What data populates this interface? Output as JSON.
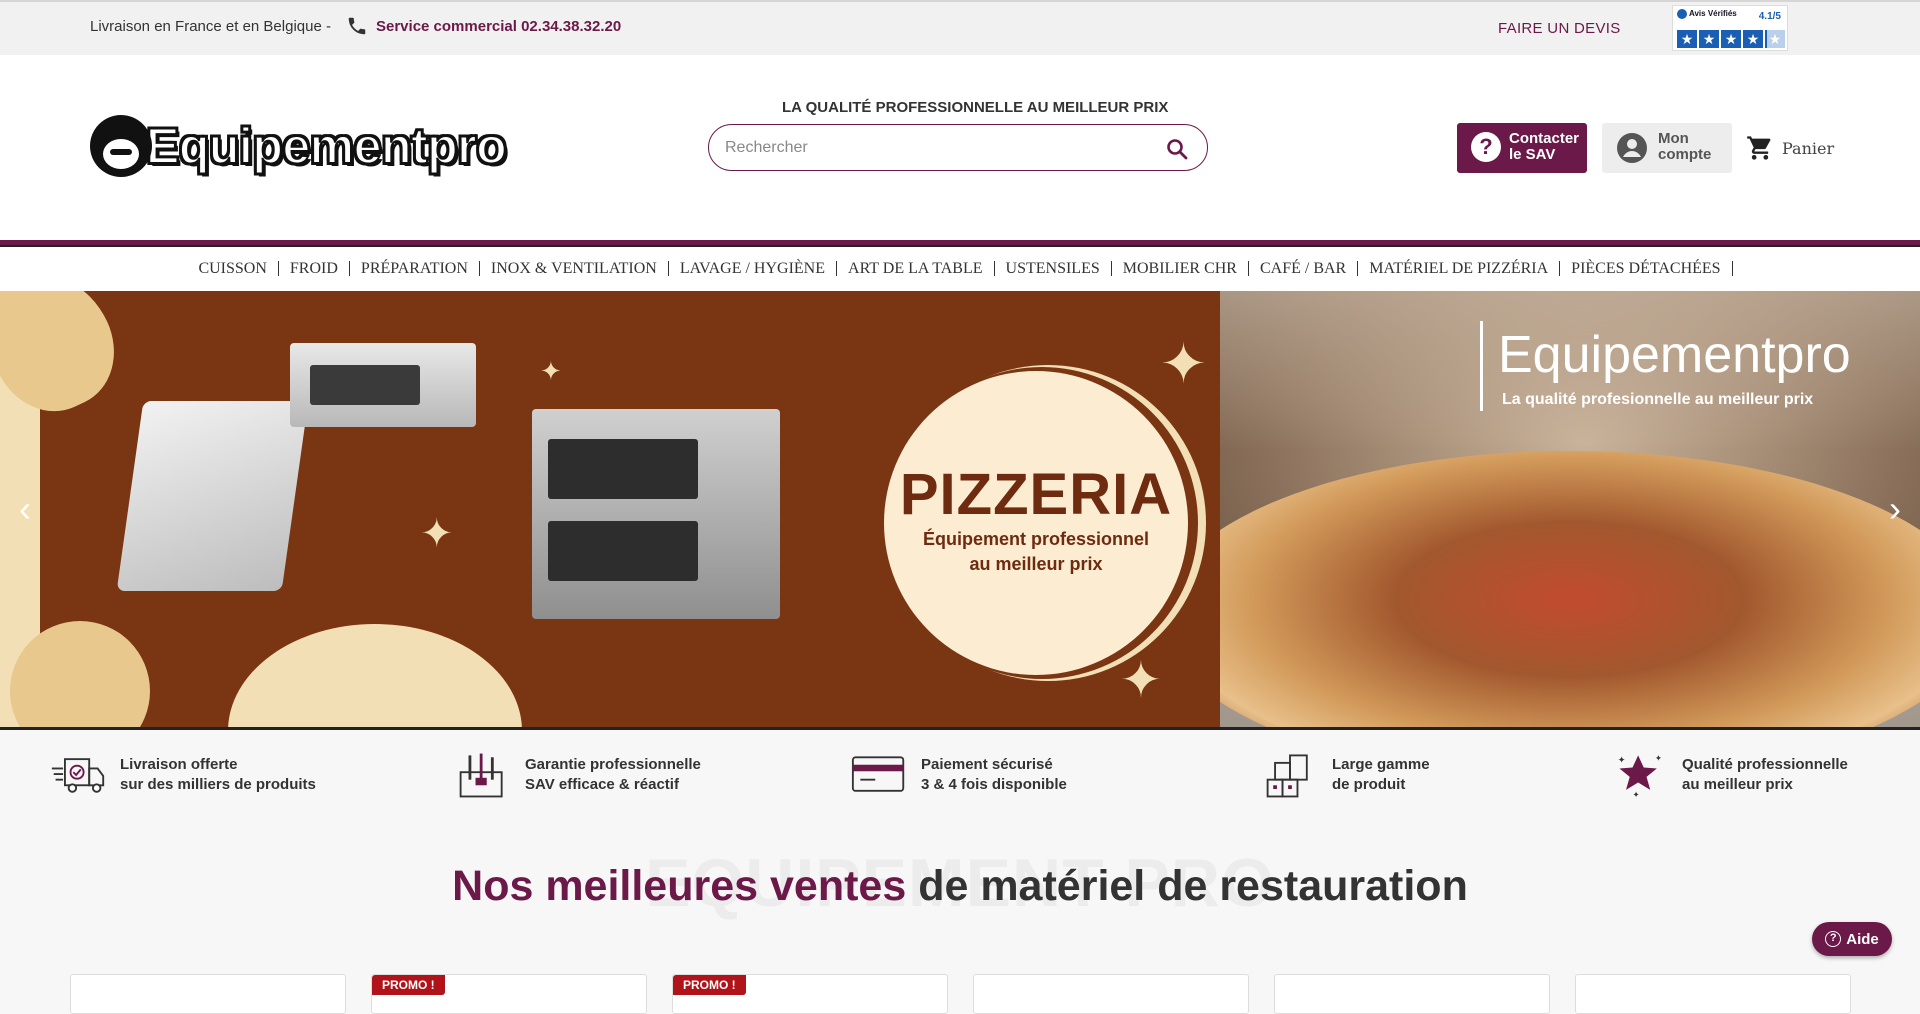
{
  "topbar": {
    "delivery_text": "Livraison en France et en Belgique -",
    "phone_label": "Service commercial 02.34.38.32.20",
    "devis_label": "FAIRE UN DEVIS",
    "avis": {
      "brand": "Avis Vérifiés",
      "score": "4.1/5",
      "stars": 4.1
    }
  },
  "header": {
    "logo_text": "Equipementpro",
    "tagline": "LA QUALITÉ PROFESSIONNELLE AU MEILLEUR PRIX",
    "search_placeholder": "Rechercher",
    "sav_label": "Contacter le SAV",
    "account_label": "Mon compte",
    "cart_label": "Panier"
  },
  "nav": {
    "items": [
      "CUISSON",
      "FROID",
      "PRÉPARATION",
      "INOX & VENTILATION",
      "LAVAGE / HYGIÈNE",
      "ART DE LA TABLE",
      "USTENSILES",
      "MOBILIER CHR",
      "CAFÉ / BAR",
      "MATÉRIEL DE PIZZÉRIA",
      "PIÈCES DÉTACHÉES"
    ]
  },
  "banner": {
    "headline": "PIZZERIA",
    "subline_1": "Équipement professionnel",
    "subline_2": "au meilleur prix",
    "brand": "Equipementpro",
    "brand_tagline": "La qualité profesionnelle au meilleur prix"
  },
  "reassurance": [
    {
      "icon": "truck-icon",
      "line1": "Livraison offerte",
      "line2": "sur des milliers de produits"
    },
    {
      "icon": "toolbox-icon",
      "line1": "Garantie professionnelle",
      "line2": "SAV efficace & réactif"
    },
    {
      "icon": "credit-card-icon",
      "line1": "Paiement sécurisé",
      "line2": "3 & 4 fois disponible"
    },
    {
      "icon": "boxes-icon",
      "line1": "Large gamme",
      "line2": "de produit"
    },
    {
      "icon": "star-icon",
      "line1": "Qualité professionnelle",
      "line2": "au meilleur prix"
    }
  ],
  "section": {
    "ghost_text": "EQUIPEMENT PRO",
    "title_accent": "Nos meilleures ventes",
    "title_rest": " de matériel de restauration"
  },
  "cards": [
    {
      "badge": ""
    },
    {
      "badge": "PROMO !"
    },
    {
      "badge": "PROMO !"
    },
    {
      "badge": ""
    },
    {
      "badge": ""
    },
    {
      "badge": ""
    }
  ],
  "help": {
    "label": "Aide"
  },
  "colors": {
    "brand": "#6b1948",
    "promo": "#b0141a",
    "banner_brown": "#7a3512"
  }
}
